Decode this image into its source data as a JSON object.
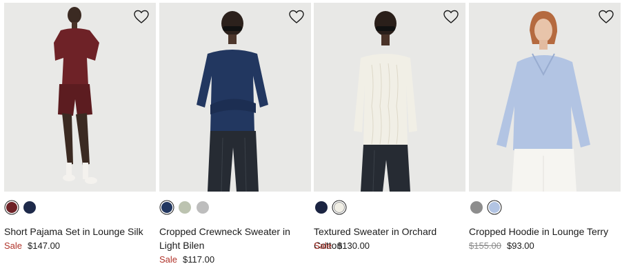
{
  "products": [
    {
      "name": "Short Pajama Set in Lounge Silk",
      "price_label": "Sale",
      "price": "$147.00",
      "colors": [
        {
          "name": "burgundy",
          "hex": "#6e2227",
          "selected": true
        },
        {
          "name": "navy",
          "hex": "#1e2a4a",
          "selected": false
        }
      ]
    },
    {
      "name": "Cropped Crewneck Sweater in Light Bilen",
      "price_label": "Sale",
      "price": "$117.00",
      "colors": [
        {
          "name": "navy",
          "hex": "#223760",
          "selected": true
        },
        {
          "name": "sage",
          "hex": "#bcc3b0",
          "selected": false
        },
        {
          "name": "grey",
          "hex": "#bdbdbd",
          "selected": false
        }
      ]
    },
    {
      "name": "Textured Sweater in Orchard Cotton",
      "price_label": "Sale",
      "price": "$130.00",
      "colors": [
        {
          "name": "navy",
          "hex": "#1b2442",
          "selected": false
        },
        {
          "name": "ivory",
          "hex": "#f1efe6",
          "selected": true
        }
      ]
    },
    {
      "name": "Cropped Hoodie in Lounge Terry",
      "original_price": "$155.00",
      "price": "$93.00",
      "colors": [
        {
          "name": "grey",
          "hex": "#8d8d8d",
          "selected": false
        },
        {
          "name": "light blue",
          "hex": "#b2c4e3",
          "selected": true
        }
      ]
    }
  ],
  "icons": {
    "wishlist": "heart-outline-icon"
  },
  "colors": {
    "sale_red": "#b0332a",
    "strike_grey": "#8a8a8a",
    "photo_bg": "#e8e8e6"
  }
}
